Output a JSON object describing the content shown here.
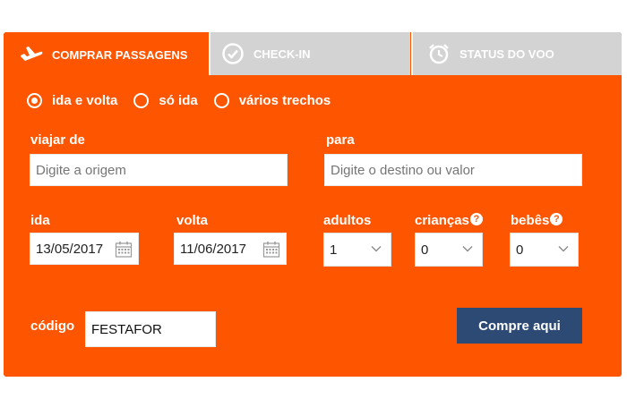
{
  "tabs": [
    {
      "label": "COMPRAR PASSAGENS",
      "icon": "airplane-icon",
      "active": true
    },
    {
      "label": "CHECK-IN",
      "icon": "checkmark-circle-icon",
      "active": false
    },
    {
      "label": "STATUS DO VOO",
      "icon": "alarm-clock-icon",
      "active": false
    }
  ],
  "trip_type": {
    "options": [
      "ida e volta",
      "só ida",
      "vários trechos"
    ],
    "selected": "ida e volta"
  },
  "origin": {
    "label": "viajar de",
    "placeholder": "Digite a origem"
  },
  "destination": {
    "label": "para",
    "placeholder": "Digite o destino ou valor"
  },
  "depart": {
    "label": "ida",
    "value": "13/05/2017"
  },
  "return": {
    "label": "volta",
    "value": "11/06/2017"
  },
  "adults": {
    "label": "adultos",
    "value": "1"
  },
  "children": {
    "label": "crianças",
    "value": "0",
    "help": "?"
  },
  "infants": {
    "label": "bebês",
    "value": "0",
    "help": "?"
  },
  "promo": {
    "label": "código",
    "value": "FESTAFOR"
  },
  "submit_label": "Compre aqui",
  "colors": {
    "brand": "#fe5500",
    "button": "#2c4a73",
    "tab_inactive": "#d3d3d3"
  }
}
